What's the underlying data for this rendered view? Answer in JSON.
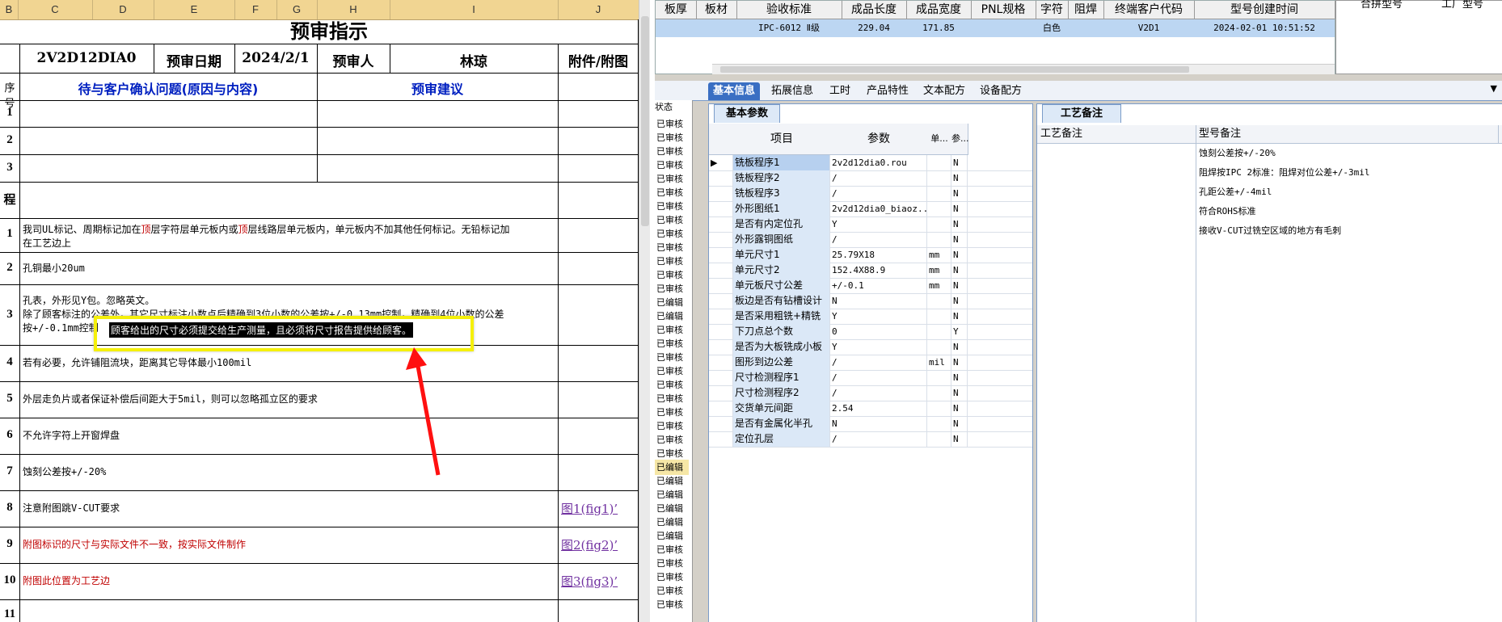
{
  "sheet": {
    "columns": [
      "B",
      "C",
      "D",
      "E",
      "F",
      "G",
      "H",
      "I",
      "J"
    ],
    "title": "预审指示",
    "info": {
      "part_no": "2V2D12DIA0",
      "date_label": "预审日期",
      "date": "2024/2/1",
      "reviewer_label": "预审人",
      "reviewer": "林琼",
      "attach_label": "附件/附图"
    },
    "issues_header": "待与客户确认问题(原因与内容)",
    "suggest_header": "预审建议",
    "seq_header": "序号",
    "rows": [
      {
        "num": "1",
        "text": ""
      },
      {
        "num": "2",
        "text": ""
      },
      {
        "num": "3",
        "text": ""
      }
    ],
    "process_label": "程",
    "process_rows": [
      {
        "num": "1",
        "text_a": "我司UL标记、周期标记加在",
        "red1": "顶",
        "text_b": "层字符层单元板内或",
        "red2": "顶",
        "text_c": "层线路层单元板内，单元板内不加其他任何标记。无铅标记加",
        "line2": "在工艺边上",
        "figure": ""
      },
      {
        "num": "2",
        "text": "孔铜最小20um",
        "figure": ""
      },
      {
        "num": "3",
        "line1": "孔表，外形见Y包。忽略英文。",
        "line2": "除了顾客标注的公差外，其它尺寸标注小数点后精确到3位小数的公差按+/-0.13mm控制，精确到4位小数的公差",
        "line3": "按+/-0.1mm控制",
        "highlight": "顾客给出的尺寸必须提交给生产测量，且必须将尺寸报告提供给顾客。",
        "figure": ""
      },
      {
        "num": "4",
        "text": "若有必要，允许铺阻流块，距离其它导体最小100mil",
        "figure": ""
      },
      {
        "num": "5",
        "text": "外层走负片或者保证补偿后间距大于5mil，则可以忽略孤立区的要求",
        "figure": ""
      },
      {
        "num": "6",
        "text": "不允许字符上开窗焊盘",
        "figure": ""
      },
      {
        "num": "7",
        "text": "蚀刻公差按+/-20%",
        "figure": ""
      },
      {
        "num": "8",
        "text": "注意附图跳V-CUT要求",
        "figure": "图1(fig1)’",
        "red": false
      },
      {
        "num": "9",
        "text": "附图标识的尺寸与实际文件不一致，按实际文件制作",
        "figure": "图2(fig2)’",
        "red": true
      },
      {
        "num": "10",
        "text": "附图此位置为工艺边",
        "figure": "图3(fig3)’",
        "red": true
      },
      {
        "num": "11",
        "text": "",
        "figure": ""
      }
    ]
  },
  "app": {
    "top_columns": [
      "板厚",
      "板材",
      "验收标准",
      "成品长度",
      "成品宽度",
      "PNL规格",
      "字符",
      "阻焊",
      "终端客户代码",
      "型号创建时间"
    ],
    "top_row": {
      "standard": "IPC-6012 Ⅱ级",
      "length": "229.04",
      "width": "171.85",
      "char": "白色",
      "customer": "V2D1",
      "created": "2024-02-01 10:51:52"
    },
    "right_top_labels": [
      "合拼型号",
      "工厂型号"
    ],
    "tabs": [
      "基本信息",
      "拓展信息",
      "工时",
      "产品特性",
      "文本配方",
      "设备配方"
    ],
    "status_header": "状态",
    "status_items": [
      "已审核",
      "已审核",
      "已审核",
      "已审核",
      "已审核",
      "已审核",
      "已审核",
      "已审核",
      "已审核",
      "已审核",
      "已审核",
      "已审核",
      "已审核",
      "已编辑",
      "已编辑",
      "已审核",
      "已审核",
      "已审核",
      "已审核",
      "已审核",
      "已审核",
      "已审核",
      "已审核",
      "已审核",
      "已审核",
      "已编辑",
      "已编辑",
      "已编辑",
      "已编辑",
      "已编辑",
      "已编辑",
      "已审核",
      "已审核",
      "已审核",
      "已审核",
      "已审核"
    ],
    "param_tab": "基本参数",
    "param_headers": {
      "item": "项目",
      "value": "参数",
      "unit": "单...",
      "ref": "参..."
    },
    "params": [
      {
        "item": "铣板程序1",
        "value": "2v2d12dia0.rou",
        "unit": "",
        "ref": "N"
      },
      {
        "item": "铣板程序2",
        "value": "/",
        "unit": "",
        "ref": "N"
      },
      {
        "item": "铣板程序3",
        "value": "/",
        "unit": "",
        "ref": "N"
      },
      {
        "item": "外形图纸1",
        "value": "2v2d12dia0_biaoz...",
        "unit": "",
        "ref": "N"
      },
      {
        "item": "是否有内定位孔",
        "value": "Y",
        "unit": "",
        "ref": "N"
      },
      {
        "item": "外形露铜图纸",
        "value": "/",
        "unit": "",
        "ref": "N"
      },
      {
        "item": "单元尺寸1",
        "value": "25.79X18",
        "unit": "mm",
        "ref": "N"
      },
      {
        "item": "单元尺寸2",
        "value": "152.4X88.9",
        "unit": "mm",
        "ref": "N"
      },
      {
        "item": "单元板尺寸公差",
        "value": "+/-0.1",
        "unit": "mm",
        "ref": "N"
      },
      {
        "item": "板边是否有钻槽设计",
        "value": "N",
        "unit": "",
        "ref": "N"
      },
      {
        "item": "是否采用粗铣+精铣",
        "value": "Y",
        "unit": "",
        "ref": "N"
      },
      {
        "item": "下刀点总个数",
        "value": "0",
        "unit": "",
        "ref": "Y"
      },
      {
        "item": "是否为大板铣成小板",
        "value": "Y",
        "unit": "",
        "ref": "N"
      },
      {
        "item": "图形到边公差",
        "value": "/",
        "unit": "mil",
        "ref": "N"
      },
      {
        "item": "尺寸检测程序1",
        "value": "/",
        "unit": "",
        "ref": "N"
      },
      {
        "item": "尺寸检测程序2",
        "value": "/",
        "unit": "",
        "ref": "N"
      },
      {
        "item": "交货单元间距",
        "value": "2.54",
        "unit": "",
        "ref": "N"
      },
      {
        "item": "是否有金属化半孔",
        "value": "N",
        "unit": "",
        "ref": "N"
      },
      {
        "item": "定位孔层",
        "value": "/",
        "unit": "",
        "ref": "N"
      }
    ],
    "note_tab": "工艺备注",
    "note_headers": [
      "工艺备注",
      "型号备注"
    ],
    "notes": [
      "蚀刻公差按+/-20%",
      "阻焊按IPC 2标准：阻焊对位公差+/-3mil",
      "孔距公差+/-4mil",
      "符合ROHS标准",
      "接收V-CUT过铣空区域的地方有毛刺"
    ]
  }
}
